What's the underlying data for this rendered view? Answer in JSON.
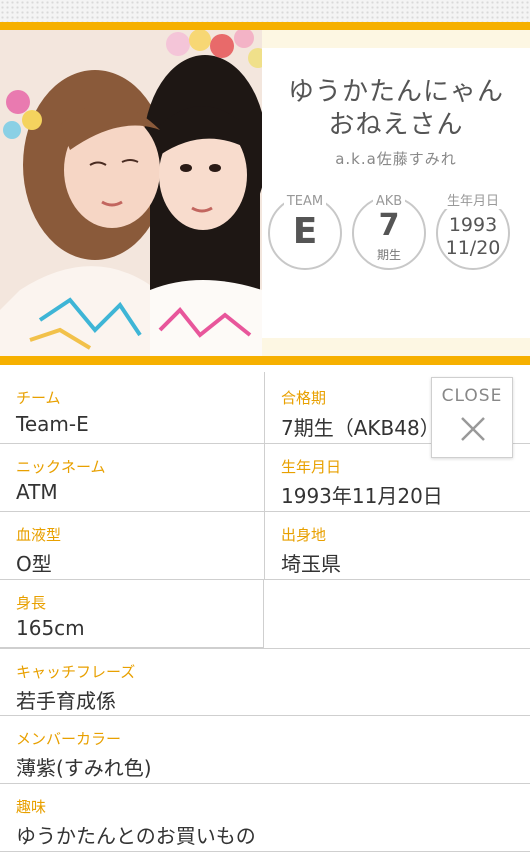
{
  "profile": {
    "nickname_line1": "ゆうかたんにゃん",
    "nickname_line2": "おねえさん",
    "aka": "a.k.a佐藤すみれ"
  },
  "badges": {
    "team_label": "TEAM",
    "team_value": "E",
    "gen_label": "AKB",
    "gen_value": "7",
    "gen_suffix": "期生",
    "birth_label": "生年月日",
    "birth_year": "1993",
    "birth_md": "11/20"
  },
  "close": {
    "label": "CLOSE",
    "icon": "close-x-icon"
  },
  "details": {
    "team": {
      "label": "チーム",
      "value": "Team-E"
    },
    "generation": {
      "label": "合格期",
      "value": "7期生（AKB48）"
    },
    "nickname": {
      "label": "ニックネーム",
      "value": "ATM"
    },
    "birthday": {
      "label": "生年月日",
      "value": "1993年11月20日"
    },
    "blood": {
      "label": "血液型",
      "value": "O型"
    },
    "hometown": {
      "label": "出身地",
      "value": "埼玉県"
    },
    "height": {
      "label": "身長",
      "value": "165cm"
    },
    "catchphrase": {
      "label": "キャッチフレーズ",
      "value": "若手育成係"
    },
    "member_color": {
      "label": "メンバーカラー",
      "value": "薄紫(すみれ色)"
    },
    "hobby": {
      "label": "趣味",
      "value": "ゆうかたんとのお買いもの"
    }
  },
  "colors": {
    "accent": "#f6b000",
    "label": "#e8a000",
    "panel": "#fdf7e3"
  }
}
